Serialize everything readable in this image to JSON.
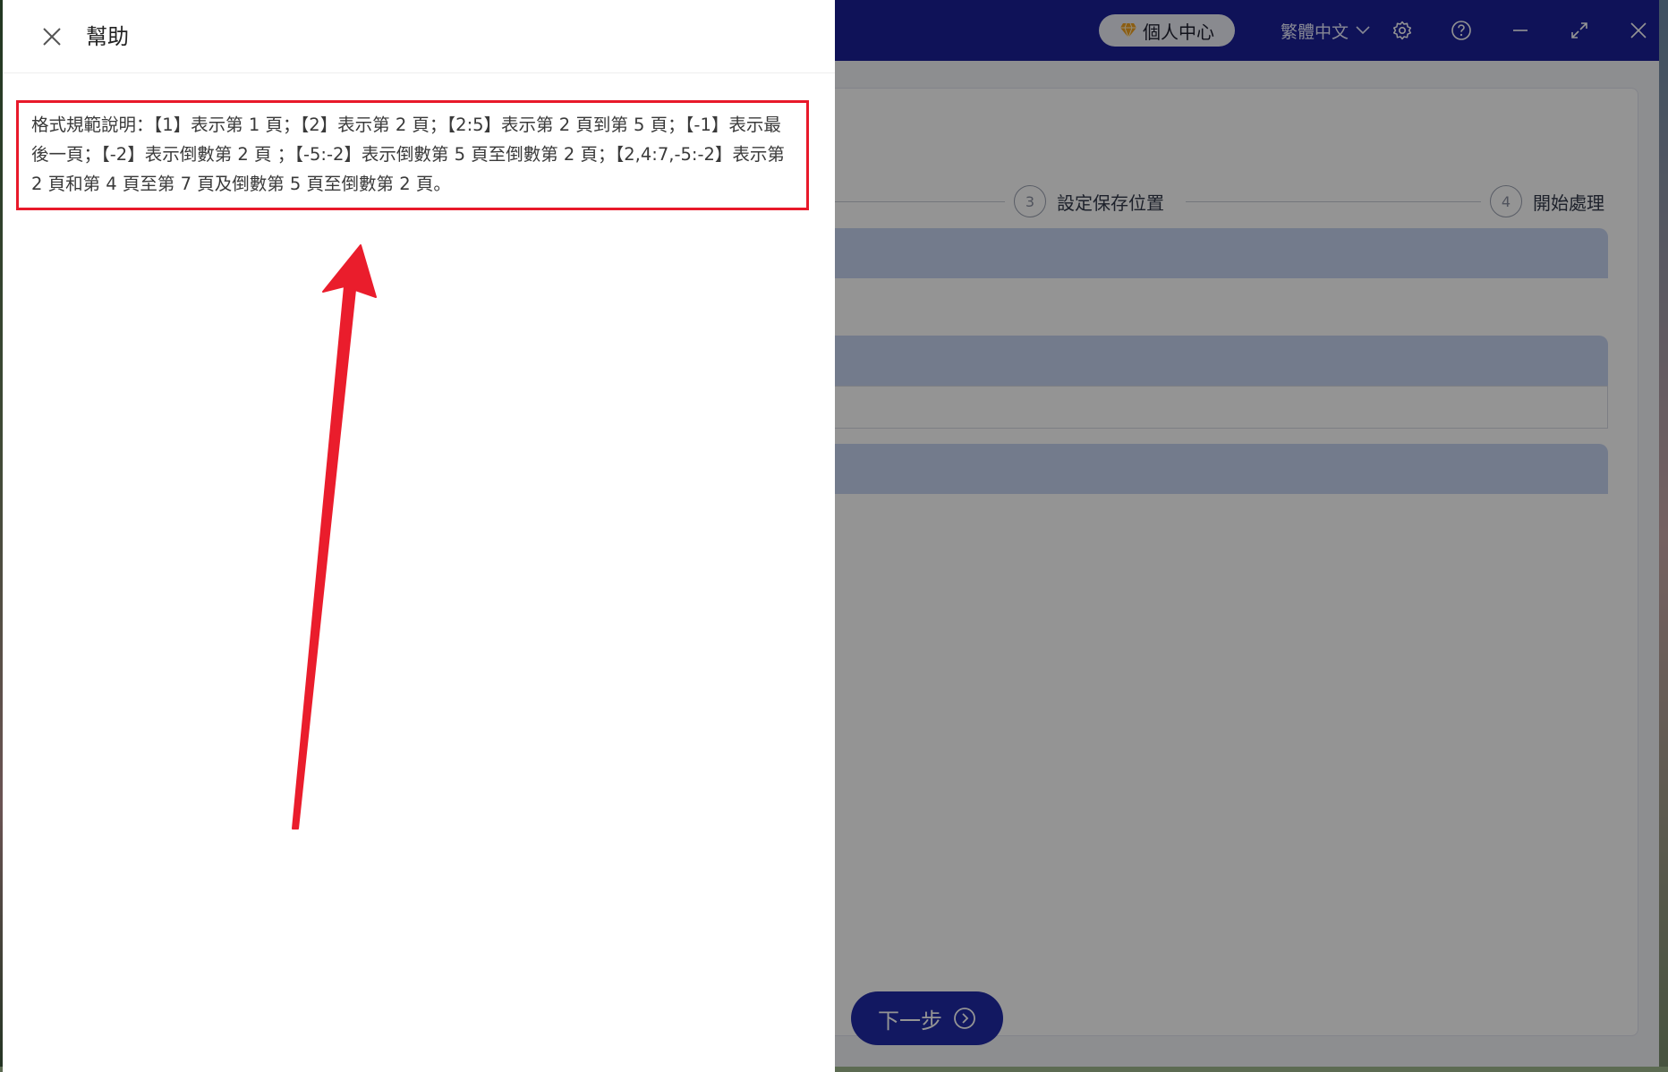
{
  "app": {
    "titlebar": {
      "vip_label": "個人中心",
      "language": "繁體中文",
      "icons": [
        "vip-diamond-icon",
        "chevron-down-icon",
        "settings-gear-icon",
        "help-icon",
        "minimize-icon",
        "maximize-icon",
        "close-icon"
      ]
    },
    "steps": [
      {
        "num": "3",
        "label": "設定保存位置"
      },
      {
        "num": "4",
        "label": "開始處理"
      }
    ],
    "next_button": "下一步"
  },
  "help_drawer": {
    "title": "幫助",
    "text": "格式規範說明：【1】表示第 1 頁；【2】表示第 2 頁；【2:5】表示第 2 頁到第 5 頁；【-1】表示最後一頁；【-2】表示倒數第 2 頁 ；【-5:-2】表示倒數第 5 頁至倒數第 2 頁；【2,4:7,-5:-2】表示第 2 頁和第 4 頁至第 7 頁及倒數第 5 頁至倒數第 2 頁。"
  },
  "colors": {
    "titlebar": "#1b2098",
    "accent": "#1f2aa8",
    "section_bar": "#c7d4f2",
    "highlight": "#e8192a"
  }
}
